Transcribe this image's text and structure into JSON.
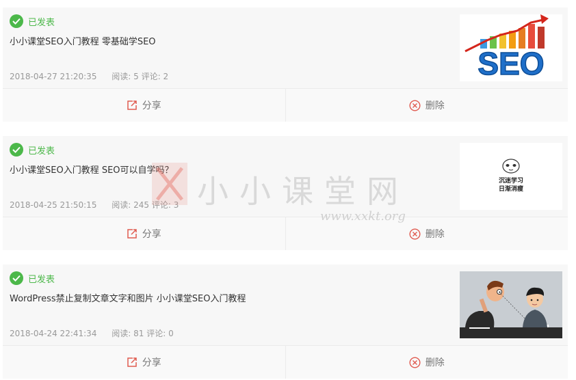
{
  "posts": [
    {
      "status": "已发表",
      "title": "小小课堂SEO入门教程 零基础学SEO",
      "date": "2018-04-27 21:20:35",
      "stats": "阅读: 5 评论: 2",
      "thumbnail": {
        "text": "SEO",
        "icon": "seo-growth-chart"
      },
      "share_label": "分享",
      "delete_label": "删除"
    },
    {
      "status": "已发表",
      "title": "小小课堂SEO入门教程 SEO可以自学吗？",
      "date": "2018-04-25 21:50:15",
      "stats": "阅读: 245 评论: 3",
      "thumbnail": {
        "line1": "沉迷学习",
        "line2": "日渐消瘦",
        "icon": "panda-meme"
      },
      "share_label": "分享",
      "delete_label": "删除"
    },
    {
      "status": "已发表",
      "title": "WordPress禁止复制文章文字和图片 小小课堂SEO入门教程",
      "date": "2018-04-24 22:41:34",
      "stats": "阅读: 81 评论: 0",
      "thumbnail": {
        "icon": "cartoon-copying-people"
      },
      "share_label": "分享",
      "delete_label": "删除"
    }
  ],
  "watermark": {
    "text": "小小课堂网",
    "url": "www.xxkt.org"
  },
  "colors": {
    "status_green": "#4cb84a",
    "icon_red": "#e05a4f",
    "text": "#333333",
    "meta": "#999999"
  }
}
